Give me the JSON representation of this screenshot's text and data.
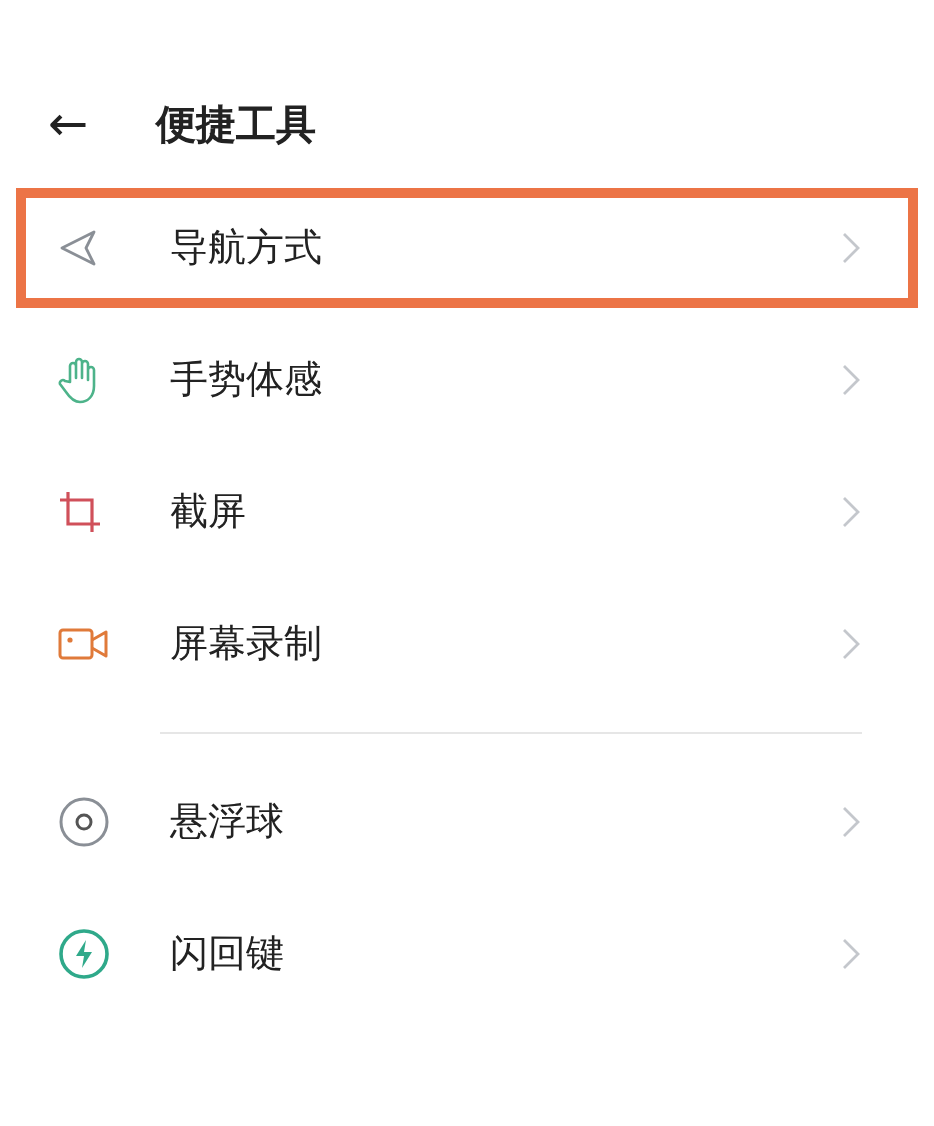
{
  "header": {
    "back": "←",
    "title": "便捷工具"
  },
  "groups": [
    {
      "items": [
        {
          "kind": "navigation",
          "label": "导航方式",
          "highlighted": true
        },
        {
          "kind": "gesture",
          "label": "手势体感",
          "highlighted": false
        },
        {
          "kind": "screenshot",
          "label": "截屏",
          "highlighted": false
        },
        {
          "kind": "record",
          "label": "屏幕录制",
          "highlighted": false
        }
      ]
    },
    {
      "items": [
        {
          "kind": "floatball",
          "label": "悬浮球",
          "highlighted": false
        },
        {
          "kind": "flash",
          "label": "闪回键",
          "highlighted": false
        }
      ]
    }
  ]
}
